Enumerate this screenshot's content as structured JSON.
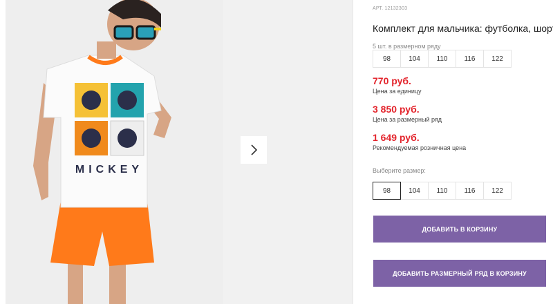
{
  "gallery": {
    "next_icon": "chevron-right-icon",
    "shirt_print_text": "MICKEY"
  },
  "product": {
    "sku": "АРТ. 12132303",
    "title": "Комплект для мальчика: футболка, шорты",
    "ryad_label": "5 шт. в размерном ряду",
    "ryad_sizes": [
      "98",
      "104",
      "110",
      "116",
      "122"
    ],
    "prices": [
      {
        "value": "770 руб.",
        "note": "Цена за единицу"
      },
      {
        "value": "3 850 руб.",
        "note": "Цена за размерный ряд"
      },
      {
        "value": "1 649 руб.",
        "note": "Рекомендуемая розничная цена"
      }
    ],
    "pick_label": "Выберите размер:",
    "pick_sizes": [
      "98",
      "104",
      "110",
      "116",
      "122"
    ],
    "selected_size": "98"
  },
  "actions": {
    "add_to_cart": "ДОБАВИТЬ В КОРЗИНУ",
    "add_ryad_to_cart": "ДОБАВИТЬ РАЗМЕРНЫЙ РЯД В КОРЗИНУ"
  },
  "colors": {
    "price": "#e3232b",
    "button": "#7d62a6",
    "shorts": "#ff7a1a"
  }
}
